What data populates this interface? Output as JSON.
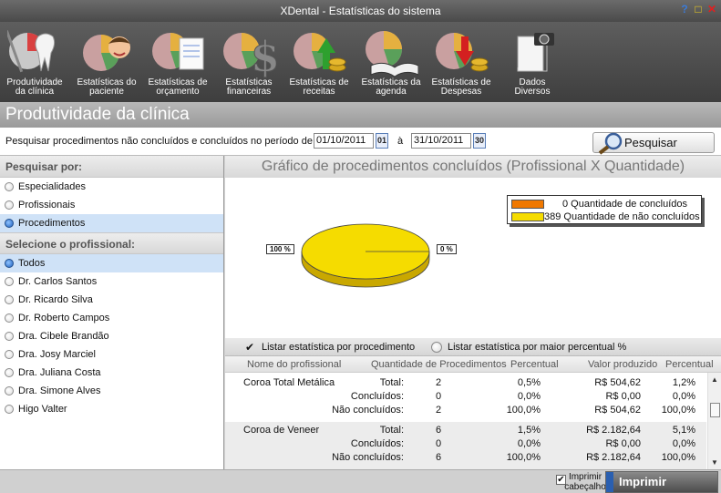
{
  "window": {
    "title": "XDental - Estatísticas do sistema",
    "controls": [
      "?",
      "□",
      "✕"
    ]
  },
  "toolbar": {
    "items": [
      {
        "label": "Produtividade\nda clínica",
        "icon": "tooth-pie-icon"
      },
      {
        "label": "Estatísticas do\npaciente",
        "icon": "patient-pie-icon"
      },
      {
        "label": "Estatísticas de\norçamento",
        "icon": "budget-pie-icon"
      },
      {
        "label": "Estatísticas\nfinanceiras",
        "icon": "dollar-pie-icon"
      },
      {
        "label": "Estatísticas de\nreceitas",
        "icon": "revenue-pie-icon"
      },
      {
        "label": "Estatísticas da\nagenda",
        "icon": "agenda-pie-icon"
      },
      {
        "label": "Estatísticas de\nDespesas",
        "icon": "expenses-pie-icon"
      },
      {
        "label": "Dados\nDiversos",
        "icon": "camera-document-icon"
      }
    ]
  },
  "section": {
    "title": "Produtividade da clínica"
  },
  "filter": {
    "label": "Pesquisar procedimentos não concluídos e concluídos no período de:",
    "date_from": "01/10/2011",
    "cal_from": "01",
    "separator": "à",
    "date_to": "31/10/2011",
    "cal_to": "30",
    "search_label": "Pesquisar"
  },
  "left": {
    "search_by_title": "Pesquisar por:",
    "search_by": [
      {
        "label": "Especialidades",
        "selected": false
      },
      {
        "label": "Profissionais",
        "selected": false
      },
      {
        "label": "Procedimentos",
        "selected": true
      }
    ],
    "professional_title": "Selecione o profissional:",
    "professionals": [
      {
        "label": "Todos",
        "selected": true
      },
      {
        "label": "Dr. Carlos Santos",
        "selected": false
      },
      {
        "label": "Dr. Ricardo Silva",
        "selected": false
      },
      {
        "label": "Dr. Roberto Campos",
        "selected": false
      },
      {
        "label": "Dra. Cibele Brandão",
        "selected": false
      },
      {
        "label": "Dra. Josy Marciel",
        "selected": false
      },
      {
        "label": "Dra. Juliana Costa",
        "selected": false
      },
      {
        "label": "Dra. Simone Alves",
        "selected": false
      },
      {
        "label": "Higo Valter",
        "selected": false
      }
    ]
  },
  "chart": {
    "title": "Gráfico de procedimentos concluídos (Profissional X Quantidade)",
    "label_left": "100 %",
    "label_right": "0 %",
    "colors": {
      "concluidos": "#f07800",
      "nao_concluidos": "#f5dc00"
    }
  },
  "chart_data": {
    "type": "pie",
    "title": "Gráfico de procedimentos concluídos (Profissional X Quantidade)",
    "slices": [
      {
        "label": "0 Quantidade de concluídos",
        "value": 0,
        "percent": 0,
        "color": "#f07800"
      },
      {
        "label": "389 Quantidade de não concluídos",
        "value": 389,
        "percent": 100,
        "color": "#f5dc00"
      }
    ],
    "legend_position": "top-right"
  },
  "options": {
    "by_procedure": {
      "label": "Listar estatística por procedimento",
      "checked": true
    },
    "by_percent": {
      "label": "Listar estatística por maior percentual %",
      "checked": false
    }
  },
  "table": {
    "headers": [
      "Nome do profissional",
      "Quantidade de Procedimentos",
      "Percentual",
      "Valor produzido",
      "Percentual"
    ],
    "groups": [
      {
        "name": "Coroa Total Metálica",
        "rows": [
          {
            "label": "Total:",
            "qty": "2",
            "pct": "0,5%",
            "value": "R$ 504,62",
            "pct2": "1,2%"
          },
          {
            "label": "Concluídos:",
            "qty": "0",
            "pct": "0,0%",
            "value": "R$ 0,00",
            "pct2": "0,0%"
          },
          {
            "label": "Não concluídos:",
            "qty": "2",
            "pct": "100,0%",
            "value": "R$ 504,62",
            "pct2": "100,0%"
          }
        ]
      },
      {
        "name": "Coroa de Veneer",
        "rows": [
          {
            "label": "Total:",
            "qty": "6",
            "pct": "1,5%",
            "value": "R$ 2.182,64",
            "pct2": "5,1%"
          },
          {
            "label": "Concluídos:",
            "qty": "0",
            "pct": "0,0%",
            "value": "R$ 0,00",
            "pct2": "0,0%"
          },
          {
            "label": "Não concluídos:",
            "qty": "6",
            "pct": "100,0%",
            "value": "R$ 2.182,64",
            "pct2": "100,0%"
          }
        ]
      }
    ]
  },
  "footer": {
    "print_header_label": "Imprimir\ncabeçalho",
    "print_header_checked": true,
    "print_label": "Imprimir"
  }
}
